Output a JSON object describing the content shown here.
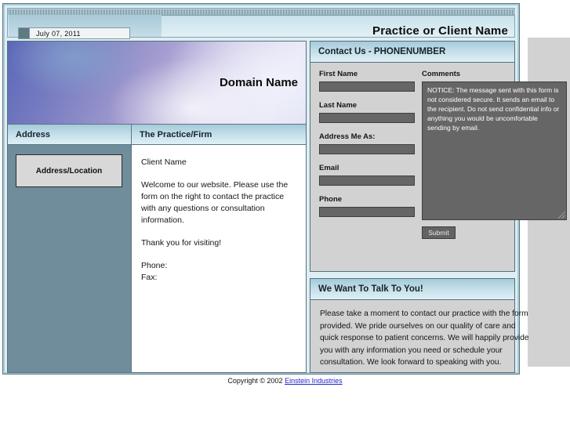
{
  "topbar": {
    "date": "July 07, 2011",
    "date_swatch_color": "#5f7a80",
    "practice_title": "Practice or Client Name"
  },
  "banner": {
    "domain_name": "Domain Name"
  },
  "table": {
    "headers": {
      "address": "Address",
      "practice": "The Practice/Firm"
    },
    "address_box_label": "Address/Location",
    "practice_body": {
      "client_name": "Client Name",
      "welcome": "Welcome to our website. Please use the form on the right to contact the practice with any questions or consultation information.",
      "thanks": "Thank you for visiting!",
      "phone_label": "Phone:",
      "fax_label": "Fax:"
    }
  },
  "contact_panel": {
    "heading": "Contact Us - PHONENUMBER",
    "fields": [
      {
        "label": "First Name",
        "value": ""
      },
      {
        "label": "Last Name",
        "value": ""
      },
      {
        "label": "Address Me As:",
        "value": ""
      },
      {
        "label": "Email",
        "value": ""
      },
      {
        "label": "Phone",
        "value": ""
      }
    ],
    "comments_label": "Comments",
    "comments_value": "NOTICE: The message sent with this form is not considered secure. It sends an email to the recipient.  Do not send confidential info or anything you would be uncomfortable sending by email.",
    "submit_label": "Submit"
  },
  "talk_panel": {
    "heading": "We Want To Talk To You!",
    "body": "Please take a moment to contact our practice with the form provided. We pride ourselves on our quality of care and quick response to patient concerns. We will happily provide you with any information you need or schedule your consultation. We look forward to speaking with you."
  },
  "footer": {
    "copyright": "Copyright © 2002",
    "link": "Einstein Industries"
  },
  "colors": {
    "panel_header_blue": "#c2dde8",
    "sidebar_blue_gray": "#6f8d9a",
    "field_gray": "#666666",
    "link_blue": "#2222cc"
  }
}
